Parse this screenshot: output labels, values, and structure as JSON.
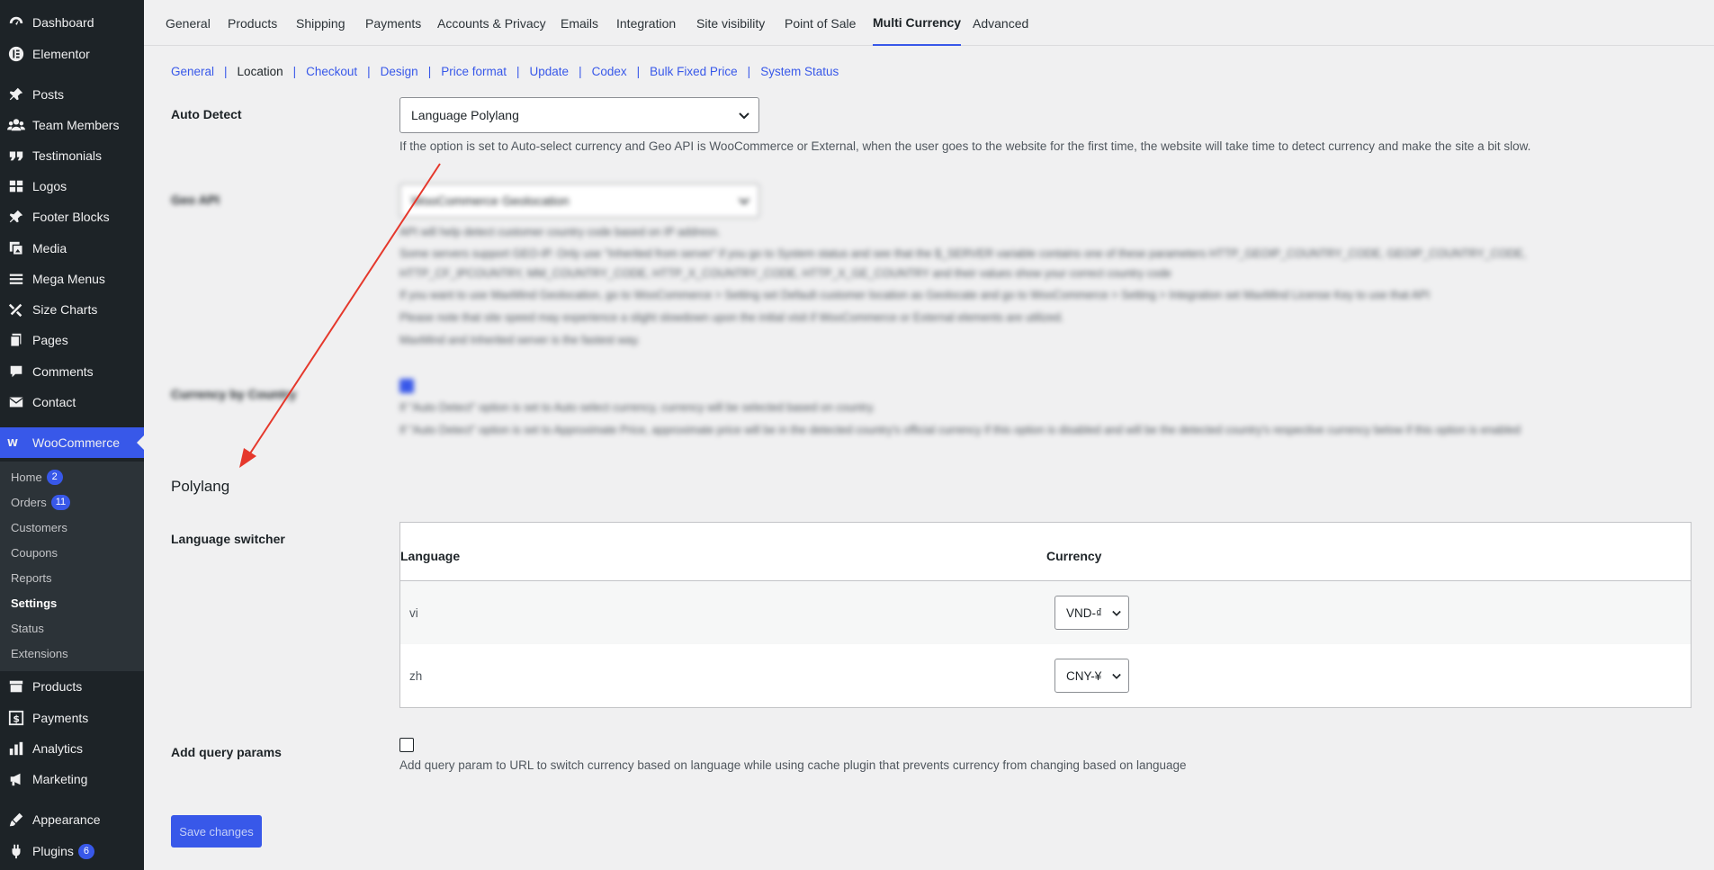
{
  "sidebar": {
    "items": [
      {
        "label": "Dashboard",
        "icon": "dashboard-icon"
      },
      {
        "label": "Elementor",
        "icon": "elementor-icon"
      },
      {
        "label": "Posts",
        "icon": "pin-icon"
      },
      {
        "label": "Team Members",
        "icon": "users-icon"
      },
      {
        "label": "Testimonials",
        "icon": "quote-icon"
      },
      {
        "label": "Logos",
        "icon": "grid-icon"
      },
      {
        "label": "Footer Blocks",
        "icon": "pin-icon"
      },
      {
        "label": "Media",
        "icon": "media-icon"
      },
      {
        "label": "Mega Menus",
        "icon": "menu-icon"
      },
      {
        "label": "Size Charts",
        "icon": "tools-icon"
      },
      {
        "label": "Pages",
        "icon": "page-icon"
      },
      {
        "label": "Comments",
        "icon": "comment-icon"
      },
      {
        "label": "Contact",
        "icon": "mail-icon"
      },
      {
        "label": "WooCommerce",
        "icon": "woo-icon"
      },
      {
        "label": "Products",
        "icon": "archive-icon"
      },
      {
        "label": "Payments",
        "icon": "dollar-icon"
      },
      {
        "label": "Analytics",
        "icon": "chart-icon"
      },
      {
        "label": "Marketing",
        "icon": "megaphone-icon"
      },
      {
        "label": "Appearance",
        "icon": "brush-icon"
      },
      {
        "label": "Plugins",
        "icon": "plugin-icon",
        "badge": "6"
      }
    ],
    "woo_submenu": [
      {
        "label": "Home",
        "badge": "2"
      },
      {
        "label": "Orders",
        "badge": "11"
      },
      {
        "label": "Customers"
      },
      {
        "label": "Coupons"
      },
      {
        "label": "Reports"
      },
      {
        "label": "Settings"
      },
      {
        "label": "Status"
      },
      {
        "label": "Extensions"
      }
    ]
  },
  "tabs": [
    "General",
    "Products",
    "Shipping",
    "Payments",
    "Accounts & Privacy",
    "Emails",
    "Integration",
    "Site visibility",
    "Point of Sale",
    "Multi Currency",
    "Advanced"
  ],
  "subtabs": [
    "General",
    "Location",
    "Checkout",
    "Design",
    "Price format",
    "Update",
    "Codex",
    "Bulk Fixed Price",
    "System Status"
  ],
  "auto_detect": {
    "label": "Auto Detect",
    "value": "Language Polylang",
    "description": "If the option is set to Auto-select currency and Geo API is WooCommerce or External, when the user goes to the website for the first time, the website will take time to detect currency and make the site a bit slow."
  },
  "geo_api": {
    "label": "Geo API",
    "value": "WooCommerce Geolocation",
    "lines": [
      "API will help detect customer country code based on IP address.",
      "Some servers support GEO-IP. Only use \"Inherited from server\" if you go to System status and see that the $_SERVER variable contains one of these parameters HTTP_GEOIP_COUNTRY_CODE, GEOIP_COUNTRY_CODE,",
      "HTTP_CF_IPCOUNTRY, MM_COUNTRY_CODE, HTTP_X_COUNTRY_CODE, HTTP_X_GE_COUNTRY and their values show your correct country code",
      "If you want to use MaxMind Geolocation, go to WooCommerce > Setting set Default customer location as Geolocate and go to WooCommerce > Setting > Integration set MaxMind License Key to use that API",
      "Please note that site speed may experience a slight slowdown upon the initial visit if WooCommerce or External elements are utilized.",
      "MaxMind and Inherited server is the fastest way."
    ]
  },
  "currency_by_country": {
    "label": "Currency by Country",
    "lines": [
      "If \"Auto Detect\" option is set to Auto select currency, currency will be selected based on country.",
      "If \"Auto Detect\" option is set to Approximate Price, approximate price will be in the detected country's official currency if this option is disabled and will be the detected country's respective currency below if this option is enabled"
    ]
  },
  "polylang": {
    "title": "Polylang",
    "switcher_label": "Language switcher",
    "col_language": "Language",
    "col_currency": "Currency",
    "rows": [
      {
        "language": "vi",
        "currency": "VND-₫"
      },
      {
        "language": "zh",
        "currency": "CNY-¥"
      }
    ]
  },
  "query_params": {
    "label": "Add query params",
    "description": "Add query param to URL to switch currency based on language while using cache plugin that prevents currency from changing based on language"
  },
  "save_label": "Save changes",
  "colors": {
    "accent": "#3858e9",
    "sidebar": "#1d2327",
    "arrow": "#e5382c"
  }
}
